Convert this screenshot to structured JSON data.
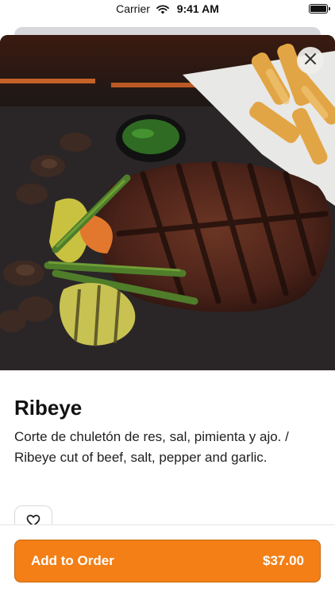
{
  "status_bar": {
    "carrier": "Carrier",
    "time": "9:41 AM"
  },
  "icons": {
    "close": "close-icon",
    "favorite": "heart-icon",
    "wifi": "wifi-icon",
    "battery": "battery-icon"
  },
  "item": {
    "name": "Ribeye",
    "description": "Corte de chuletón de res, sal, pimienta y ajo. / Ribeye cut of beef, salt, pepper and garlic.",
    "image_alt": "Grilled ribeye steak with asparagus, mushrooms, squash and fries"
  },
  "order_button": {
    "label": "Add to Order",
    "price": "$37.00"
  },
  "colors": {
    "accent": "#f37f16",
    "text": "#111111"
  }
}
